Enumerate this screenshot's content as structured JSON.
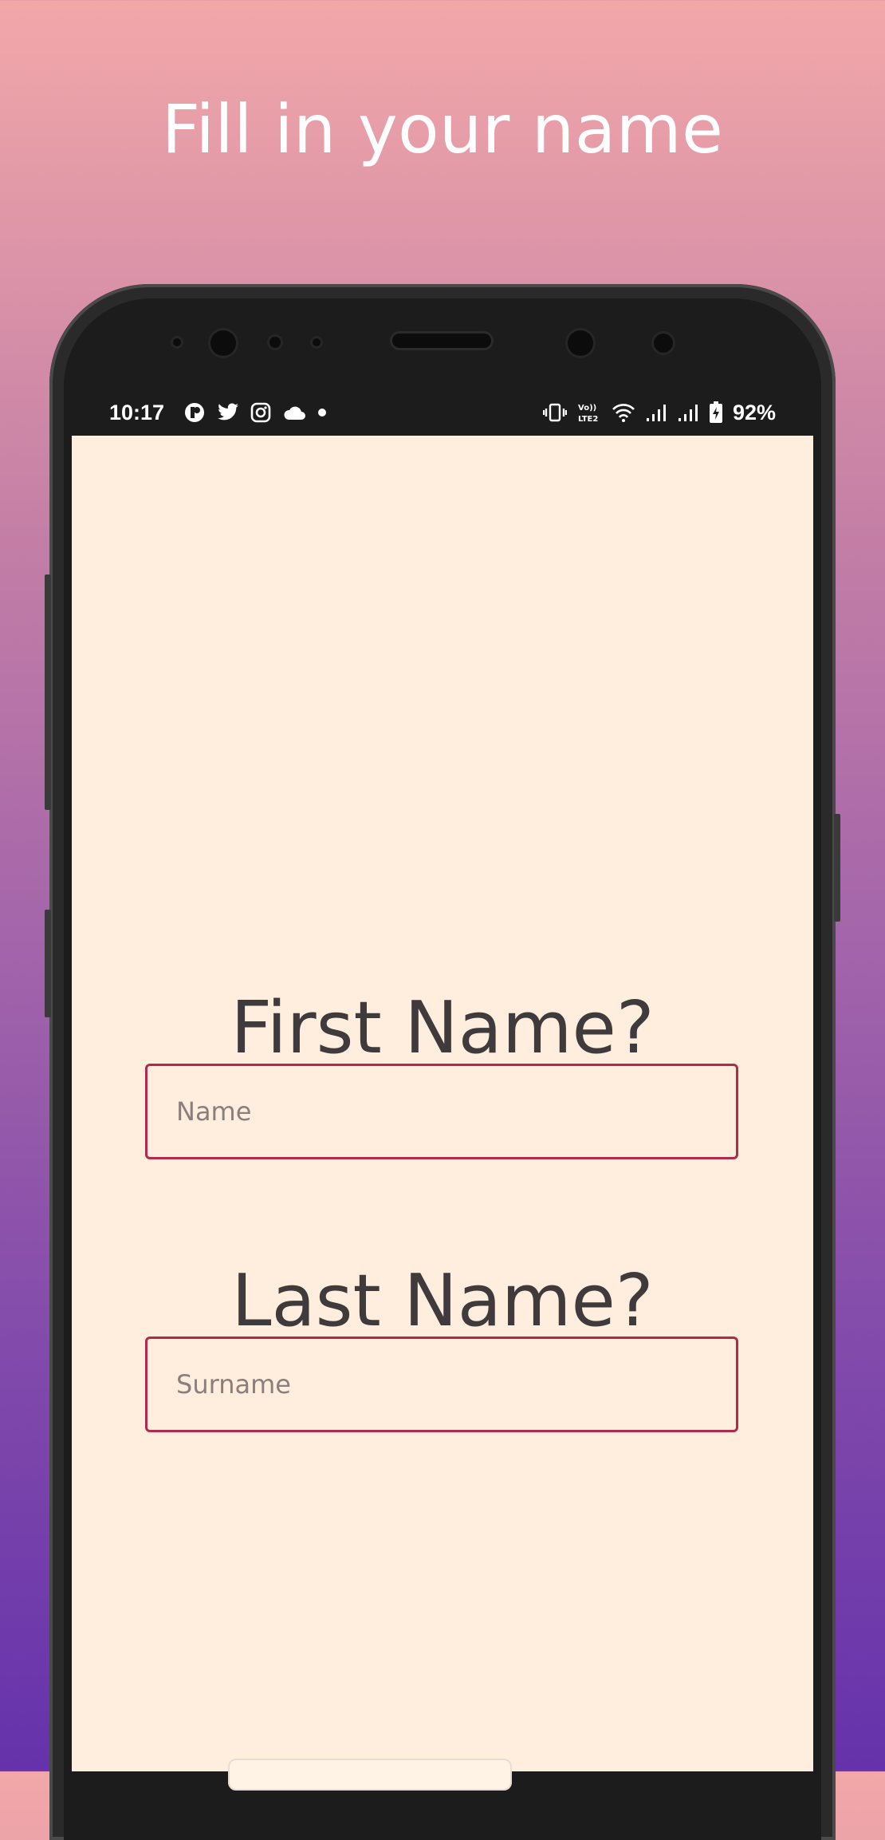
{
  "promo": {
    "title": "Fill in your name"
  },
  "status_bar": {
    "time": "10:17",
    "battery_percent": "92%",
    "left_icons": [
      "app-notification-icon",
      "twitter-icon",
      "instagram-icon",
      "cloud-icon",
      "more-notifications-dot-icon"
    ],
    "right_icons": [
      "vibrate-icon",
      "volte-lte2-icon",
      "wifi-icon",
      "signal-1-icon",
      "signal-2-icon",
      "battery-charging-icon"
    ]
  },
  "form": {
    "first_name_label": "First Name?",
    "first_name_placeholder": "Name",
    "first_name_value": "",
    "last_name_label": "Last Name?",
    "last_name_placeholder": "Surname",
    "last_name_value": ""
  },
  "colors": {
    "screen_background": "#ffeedd",
    "field_border": "#b22a4a",
    "question_text": "#3f3a3b",
    "gradient_top": "#f2a8a9",
    "gradient_bottom": "#6532ab"
  }
}
